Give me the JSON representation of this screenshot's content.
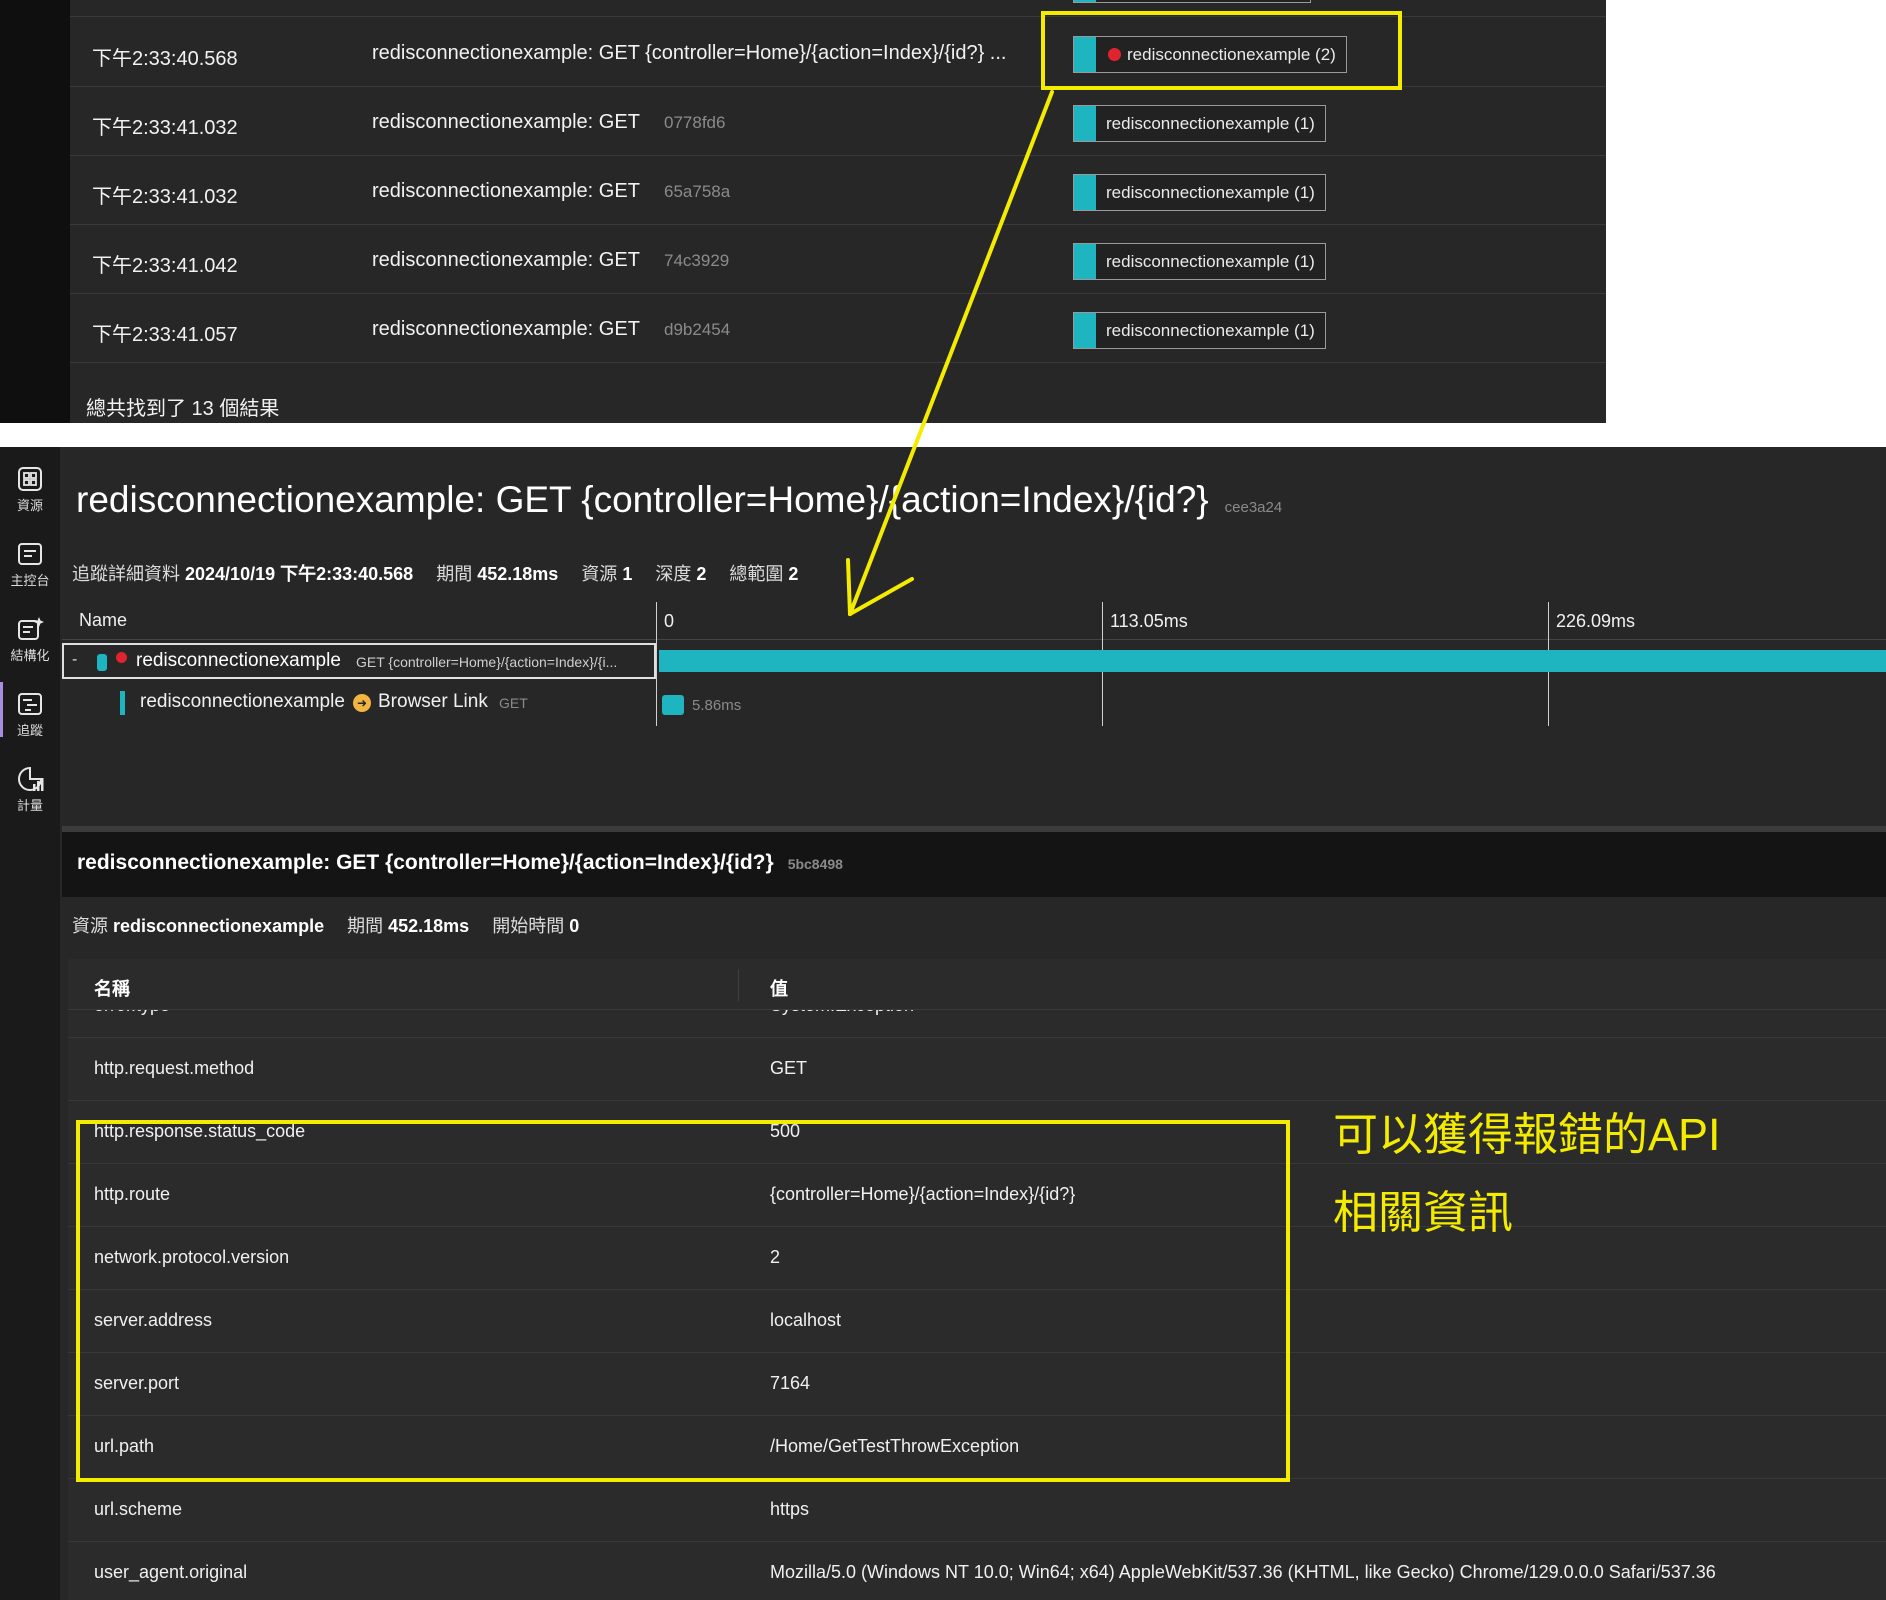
{
  "top": {
    "rows": [
      {
        "time": "下午2:33:40.568",
        "name": "redisconnectionexample: GET {controller=Home}/{action=Index}/{id?} ...",
        "id": "",
        "resource": "redisconnectionexample (2)",
        "error": true
      },
      {
        "time": "下午2:33:41.032",
        "name": "redisconnectionexample: GET",
        "id": "0778fd6",
        "resource": "redisconnectionexample (1)",
        "error": false
      },
      {
        "time": "下午2:33:41.032",
        "name": "redisconnectionexample: GET",
        "id": "65a758a",
        "resource": "redisconnectionexample (1)",
        "error": false
      },
      {
        "time": "下午2:33:41.042",
        "name": "redisconnectionexample: GET",
        "id": "74c3929",
        "resource": "redisconnectionexample (1)",
        "error": false
      },
      {
        "time": "下午2:33:41.057",
        "name": "redisconnectionexample: GET",
        "id": "d9b2454",
        "resource": "redisconnectionexample (1)",
        "error": false
      }
    ],
    "summary": "總共找到了 13 個結果"
  },
  "nav": {
    "items": [
      {
        "label": "資源",
        "icon": "resources-icon"
      },
      {
        "label": "主控台",
        "icon": "console-icon"
      },
      {
        "label": "結構化",
        "icon": "structured-icon"
      },
      {
        "label": "追蹤",
        "icon": "traces-icon"
      },
      {
        "label": "計量",
        "icon": "metrics-icon"
      }
    ],
    "active": "追蹤"
  },
  "trace": {
    "title": "redisconnectionexample: GET {controller=Home}/{action=Index}/{id?}",
    "trace_id": "cee3a24",
    "meta": {
      "detail_label": "追蹤詳細資料",
      "detail_value": "2024/10/19 下午2:33:40.568",
      "duration_label": "期間",
      "duration_value": "452.18ms",
      "resources_label": "資源",
      "resources_value": "1",
      "depth_label": "深度",
      "depth_value": "2",
      "spans_label": "總範圍",
      "spans_value": "2"
    },
    "timeline": {
      "name_header": "Name",
      "ticks": [
        "0",
        "113.05ms",
        "226.09ms"
      ],
      "spans": [
        {
          "service": "redisconnectionexample",
          "operation": "GET {controller=Home}/{action=Index}/{i...",
          "error": true,
          "collapse": "-"
        },
        {
          "service": "redisconnectionexample",
          "link_label": "Browser Link",
          "method": "GET",
          "duration": "5.86ms"
        }
      ]
    }
  },
  "span": {
    "title": "redisconnectionexample: GET {controller=Home}/{action=Index}/{id?}",
    "span_id": "5bc8498",
    "meta": {
      "resource_label": "資源",
      "resource_value": "redisconnectionexample",
      "duration_label": "期間",
      "duration_value": "452.18ms",
      "start_label": "開始時間",
      "start_value": "0"
    },
    "columns": {
      "name": "名稱",
      "value": "值"
    },
    "attributes": [
      {
        "key": "error.type",
        "value": "System.Exception"
      },
      {
        "key": "http.request.method",
        "value": "GET"
      },
      {
        "key": "http.response.status_code",
        "value": "500"
      },
      {
        "key": "http.route",
        "value": "{controller=Home}/{action=Index}/{id?}"
      },
      {
        "key": "network.protocol.version",
        "value": "2"
      },
      {
        "key": "server.address",
        "value": "localhost"
      },
      {
        "key": "server.port",
        "value": "7164"
      },
      {
        "key": "url.path",
        "value": "/Home/GetTestThrowException"
      },
      {
        "key": "url.scheme",
        "value": "https"
      },
      {
        "key": "user_agent.original",
        "value": "Mozilla/5.0 (Windows NT 10.0; Win64; x64) AppleWebKit/537.36 (KHTML, like Gecko) Chrome/129.0.0.0 Safari/537.36"
      }
    ]
  },
  "annotation": {
    "line1": "可以獲得報錯的API",
    "line2": "相關資訊",
    "color": "#f4ec00"
  },
  "colors": {
    "accent": "#1eb4c0",
    "error": "#e0242f",
    "background": "#272727"
  }
}
